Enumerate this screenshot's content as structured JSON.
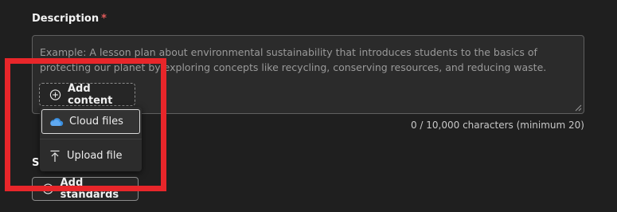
{
  "description_field": {
    "label": "Description",
    "required_marker": "*",
    "placeholder": "Example: A lesson plan about environmental sustainability that introduces students to the basics of protecting our planet by exploring concepts like recycling, conserving resources, and reducing waste.",
    "counter": "0 / 10,000 characters (minimum 20)"
  },
  "add_content_button": {
    "label": "Add content",
    "icon": "plus-circle-icon"
  },
  "add_content_menu": {
    "items": [
      {
        "label": "Cloud files",
        "icon": "cloud-icon"
      },
      {
        "label": "Upload file",
        "icon": "upload-icon"
      }
    ]
  },
  "partially_hidden_section": {
    "label_visible": "S",
    "button_label_partial": "Add standards"
  },
  "colors": {
    "background": "#1f1f1f",
    "required": "#e05a5a",
    "cloud_icon": "#3a8fe0",
    "annotation": "#e8262a"
  }
}
